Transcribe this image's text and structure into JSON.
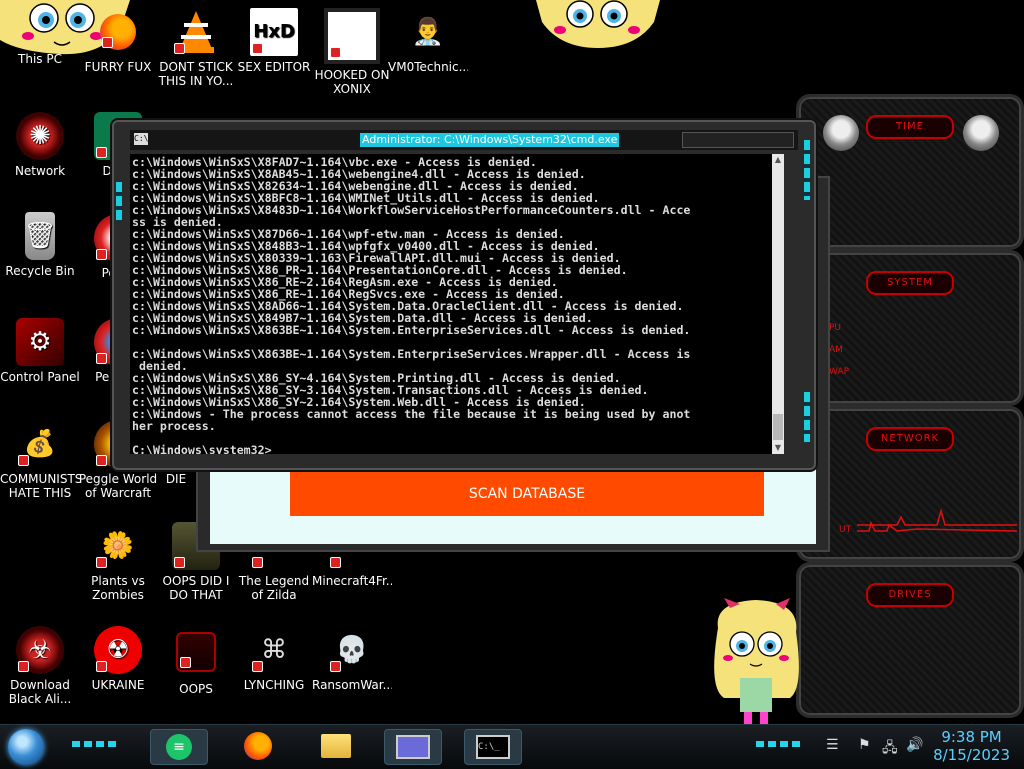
{
  "desktop_icons": [
    {
      "label": "This PC",
      "icon": "this-pc-icon"
    },
    {
      "label": "FURRY FUX",
      "icon": "firefox-icon"
    },
    {
      "label": "DONT STICK THIS IN YO...",
      "icon": "vlc-icon"
    },
    {
      "label": "SEX EDITOR",
      "icon": "hxd-editor-icon"
    },
    {
      "label": "HOOKED ON XONIX",
      "icon": "xonix-icon"
    },
    {
      "label": "VM0Technic...",
      "icon": "doctor-icon"
    },
    {
      "label": "Network",
      "icon": "network-icon"
    },
    {
      "label": "D DU",
      "icon": "app-icon"
    },
    {
      "label": "Recycle Bin",
      "icon": "recycle-bin-icon"
    },
    {
      "label": "Peggl",
      "icon": "peggle-icon"
    },
    {
      "label": "Control Panel",
      "icon": "control-panel-icon"
    },
    {
      "label": "Peggl D",
      "icon": "peggle-icon"
    },
    {
      "label": "COMMUNISTS HATE THIS G...",
      "icon": "money-bag-icon"
    },
    {
      "label": "Peggle World of Warcraft ...",
      "icon": "peggle-icon"
    },
    {
      "label": "DIE",
      "icon": "app-icon"
    },
    {
      "label": "Plants vs Zombies",
      "icon": "plants-vs-zombies-icon"
    },
    {
      "label": "OOPS DID I DO THAT",
      "icon": "portrait-icon"
    },
    {
      "label": "The Legend of Zilda",
      "icon": "zelda-icon"
    },
    {
      "label": "Minecraft4Fr...",
      "icon": "minecraft-icon"
    },
    {
      "label": "Download Black Ali...",
      "icon": "alienware-icon"
    },
    {
      "label": "UKRAINE",
      "icon": "radiation-icon"
    },
    {
      "label": "OOPS",
      "icon": "alienware-laptop-icon"
    },
    {
      "label": "LYNCHING",
      "icon": "knot-icon"
    },
    {
      "label": "RansomWar...",
      "icon": "skull-icon"
    }
  ],
  "cmd": {
    "title": "Administrator: C:\\Windows\\System32\\cmd.exe",
    "output": "c:\\Windows\\WinSxS\\X8FAD7~1.164\\vbc.exe - Access is denied.\nc:\\Windows\\WinSxS\\X8AB45~1.164\\webengine4.dll - Access is denied.\nc:\\Windows\\WinSxS\\X82634~1.164\\webengine.dll - Access is denied.\nc:\\Windows\\WinSxS\\X8BFC8~1.164\\WMINet_Utils.dll - Access is denied.\nc:\\Windows\\WinSxS\\X8483D~1.164\\WorkflowServiceHostPerformanceCounters.dll - Acce\nss is denied.\nc:\\Windows\\WinSxS\\X87D66~1.164\\wpf-etw.man - Access is denied.\nc:\\Windows\\WinSxS\\X848B3~1.164\\wpfgfx_v0400.dll - Access is denied.\nc:\\Windows\\WinSxS\\X80339~1.163\\FirewallAPI.dll.mui - Access is denied.\nc:\\Windows\\WinSxS\\X86_PR~1.164\\PresentationCore.dll - Access is denied.\nc:\\Windows\\WinSxS\\X86_RE~2.164\\RegAsm.exe - Access is denied.\nc:\\Windows\\WinSxS\\X86_RE~1.164\\RegSvcs.exe - Access is denied.\nc:\\Windows\\WinSxS\\X8AD66~1.164\\System.Data.OracleClient.dll - Access is denied.\nc:\\Windows\\WinSxS\\X849B7~1.164\\System.Data.dll - Access is denied.\nc:\\Windows\\WinSxS\\X863BE~1.164\\System.EnterpriseServices.dll - Access is denied.\n\nc:\\Windows\\WinSxS\\X863BE~1.164\\System.EnterpriseServices.Wrapper.dll - Access is\n denied.\nc:\\Windows\\WinSxS\\X86_SY~4.164\\System.Printing.dll - Access is denied.\nc:\\Windows\\WinSxS\\X86_SY~3.164\\System.Transactions.dll - Access is denied.\nc:\\Windows\\WinSxS\\X86_SY~2.164\\System.Web.dll - Access is denied.\nc:\\Windows - The process cannot access the file because it is being used by anot\nher process.\n\nC:\\Windows\\system32>_"
  },
  "back_window": {
    "scan_button": "SCAN DATABASE"
  },
  "gadgets": {
    "time_title": "TIME",
    "system_title": "SYSTEM",
    "system_rows": [
      "PU",
      "AM",
      "WAP"
    ],
    "network_title": "NETWORK",
    "network_row": "UT",
    "drives_title": "DRIVES"
  },
  "taskbar": {
    "apps": [
      "notes-icon",
      "firefox-icon",
      "file-explorer-icon",
      "presentation-icon",
      "command-prompt-icon"
    ],
    "time": "9:38 PM",
    "date": "8/15/2023"
  },
  "colors": {
    "accent_red": "#e01010",
    "scan_button": "#ff4a00",
    "title_highlight": "#1ec8e0",
    "clock": "#5ad0ff"
  }
}
